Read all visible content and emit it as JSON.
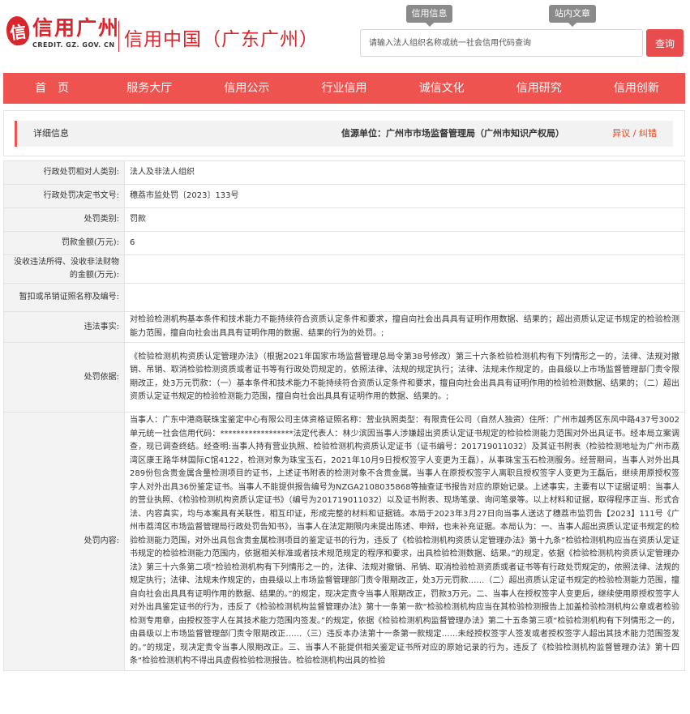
{
  "header": {
    "logo_cn": "信用广州",
    "logo_en": "CREDIT. GZ. GOV. CN",
    "site_title": "信用中国（广东广州）",
    "tab_credit_info": "信用信息",
    "tab_news_search": "站内文章",
    "search_placeholder": "请输入法人组织名称或统一社会信用代码查询",
    "search_button": "查询"
  },
  "nav": {
    "items": [
      "首　页",
      "服务大厅",
      "信用公示",
      "行业信用",
      "诚信文化",
      "信用研究",
      "信用创新"
    ]
  },
  "detail": {
    "title": "详细信息",
    "source": "信源单位：广州市市场监督管理局（广州市知识产权局）",
    "objection_link": "异议 / 纠错"
  },
  "rows": [
    {
      "label": "行政处罚相对人类别:",
      "value": "法人及非法人组织"
    },
    {
      "label": "行政处罚决定书文号:",
      "value": "穗荔市监处罚〔2023〕133号"
    },
    {
      "label": "处罚类别:",
      "value": "罚款"
    },
    {
      "label": "罚款金额(万元):",
      "value": "6"
    },
    {
      "label": "没收违法所得、没收非法财物的金额(万元):",
      "value": ""
    },
    {
      "label": "暂扣或吊销证照名称及编号:",
      "value": ""
    },
    {
      "label": "违法事实:",
      "value": "对检验检测机构基本条件和技术能力不能持续符合资质认定条件和要求，擅自向社会出具具有证明作用数据、结果的；超出资质认定证书规定的检验检测能力范围，擅自向社会出具具有证明作用的数据、结果的行为的处罚。;"
    },
    {
      "label": "处罚依据:",
      "value": "《检验检测机构资质认定管理办法》（根据2021年国家市场监督管理总局令第38号修改）第三十六条检验检测机构有下列情形之一的，法律、法规对撤销、吊销、取消检验检测资质或者证书等有行政处罚规定的，依照法律、法规的规定执行；法律、法规未作规定的，由县级以上市场监督管理部门责令限期改正，处3万元罚款：（一）基本条件和技术能力不能持续符合资质认定条件和要求，擅自向社会出具具有证明作用的检验检测数据、结果的；（二）超出资质认定证书规定的检验检测能力范围，擅自向社会出具具有证明作用的数据、结果的。;"
    },
    {
      "label": "处罚内容:",
      "value": "当事人：广东中港商联珠宝鉴定中心有限公司主体资格证照名称：营业执照类型：有限责任公司（自然人独资）住所：广州市越秀区东风中路437号3002单元统一社会信用代码：******************法定代表人：林少滨因当事人涉嫌超出资质认定证书规定的检验检测能力范围对外出具证书。经本局立案调查，现已调查终结。经查明:当事人持有营业执照、检验检测机构资质认定证书（证书编号：201719011032）及其证书附表（检验检测地址为广州市荔湾区康王路华林国际C馆4122，检测对象为珠宝玉石，2021年10月9日授权签字人变更为王磊），从事珠宝玉石检测服务。经营期间，当事人对外出具289份包含贵金属含量检测项目的证书，上述证书附表的检测对象不含贵金属。当事人在原授权签字人离职且授权签字人变更为王磊后，继续用原授权签字人对外出具36份鉴定证书。当事人不能提供报告编号为NZGA2108035868等抽查证书报告对应的原始记录。上述事实，主要有以下证据证明：当事人的营业执照、《检验检测机构资质认定证书》（编号为201719011032）以及证书附表、现场笔录、询问笔录等。以上材料和证据，取得程序正当、形式合法、内容真实，均与本案具有关联性，相互印证，形成完整的材料和证据链。本局于2023年3月27日向当事人送达了穗荔市监罚告【2023】111号《广州市荔湾区市场监督管理局行政处罚告知书》，当事人在法定期限内未提出陈述、申辩，也未补充证据。本局认为：一、当事人超出资质认定证书规定的检验检测能力范围，对外出具包含贵金属检测项目的鉴定证书的行为，违反了《检验检测机构资质认定管理办法》第十九条“检验检测机构应当在资质认定证书规定的检验检测能力范围内，依据相关标准或者技术规范规定的程序和要求，出具检验检测数据、结果。”的规定，依据《检验检测机构资质认定管理办法》第三十六条第二项“检验检测机构有下列情形之一的，法律、法规对撤销、吊销、取消检验检测资质或者证书等有行政处罚规定的，依照法律、法规的规定执行；法律、法规未作规定的，由县级以上市场监督管理部门责令限期改正，处3万元罚款……（二）超出资质认定证书规定的检验检测能力范围，擅自向社会出具具有证明作用的数据、结果的。”的规定，现决定责令当事人限期改正，罚款3万元。二、当事人在授权签字人变更后，继续使用原授权签字人对外出具鉴定证书的行为，违反了《检验检测机构监督管理办法》第十一条第一款“检验检测机构应当在其检验检测报告上加盖检验检测机构公章或者检验检测专用章，由授权签字人在其技术能力范围内签发。”的规定，依据《检验检测机构监督管理办法》第二十五条第三项“检验检测机构有下列情形之一的，由县级以上市场监督管理部门责令限期改正……（三）违反本办法第十一条第一款规定……未经授权签字人签发或者授权签字人超出其技术能力范围签发的。”的规定，现决定责令当事人限期改正。三、当事人不能提供相关鉴定证书所对应的原始记录的行为，违反了《检验检测机构监督管理办法》第十四条“检验检测机构不得出具虚假检验检测报告。检验检测机构出具的检验"
    }
  ]
}
